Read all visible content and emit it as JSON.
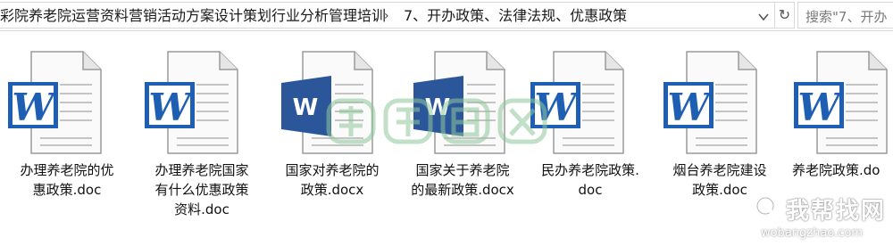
{
  "address_bar": {
    "crumbs": [
      "彩院养老院运营资料营销活动方案设计策划行业分析管理培训",
      "7、开办政策、法律法规、优惠政策"
    ],
    "separator": "›",
    "search_placeholder": "搜索\"7、开办"
  },
  "files": [
    {
      "name": "办理养老院的优\n惠政策.doc",
      "icon": "word-97-icon"
    },
    {
      "name": "办理养老院国家\n有什么优惠政策\n资料.doc",
      "icon": "word-97-icon"
    },
    {
      "name": "国家对养老院的\n政策.docx",
      "icon": "word-2013-icon"
    },
    {
      "name": "国家关于养老院\n的最新政策.docx",
      "icon": "word-2013-icon"
    },
    {
      "name": "民办养老院政策.\ndoc",
      "icon": "word-97-icon"
    },
    {
      "name": "烟台养老院建设\n政策.doc",
      "icon": "word-97-icon"
    },
    {
      "name": "养老院政策.do",
      "icon": "word-97-icon"
    }
  ],
  "watermark": {
    "text": "我帮找网",
    "url": "wobangzhao.com"
  },
  "colors": {
    "word_blue": "#2b579a",
    "word_old_blue": "#1f5fb3",
    "watermark_green": "#8fc79a"
  }
}
